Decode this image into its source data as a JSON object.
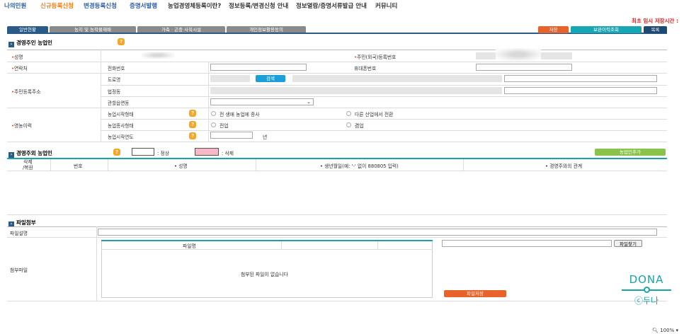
{
  "topnav": {
    "items": [
      "나의민원",
      "신규등록신청",
      "변경등록신청",
      "증명서발행",
      "농업경영체등록이란?",
      "정보등록/변경신청 안내",
      "정보열람/증명서류발급 안내",
      "커뮤니티"
    ],
    "colors": [
      "#2b5caa",
      "#f07d1a",
      "#2b5caa",
      "#2b5caa",
      "#333333",
      "#333333",
      "#333333",
      "#333333"
    ]
  },
  "save_time_label": "최초 임시 저장시간 :",
  "tabs": [
    "일반현황",
    "농지 및 농작물재배",
    "가축 · 곤충 사육시설",
    "개인정보활용동의"
  ],
  "buttons": {
    "save": "저장",
    "history": "보완이력조회",
    "list": "목록"
  },
  "sections": {
    "operator": {
      "title": "경영주인 농업인",
      "name_label": "성명",
      "resident_label": "주민(외국)등록번호",
      "contact_label": "연락처",
      "phone_label": "전화번호",
      "mobile_label": "휴대폰번호",
      "address_label": "주민등록주소",
      "road_label": "도로명",
      "search_btn": "검색",
      "legal_label": "법정동",
      "district_label": "관할읍면동",
      "career_label": "영농이력",
      "start_type_label": "농업시작형태",
      "start_opt1": "전 생애 농업에 종사",
      "start_opt2": "다른 산업에서 전환",
      "work_type_label": "농업종사형태",
      "work_opt1": "전업",
      "work_opt2": "겸업",
      "start_year_label": "농업시작연도",
      "year_unit": "년"
    },
    "members": {
      "title": "경영주외 농업인",
      "legend_normal": ": 정상",
      "legend_deleted": ": 삭제",
      "add_btn": "농업인추가",
      "columns": [
        "삭제\n/복원",
        "번호",
        "• 성명",
        "• 생년월일(예: '-' 없이 880805 입력)",
        "• 경영주와의 관계"
      ]
    },
    "files": {
      "title": "파일첨부",
      "desc_label": "파일설명",
      "attach_label": "첨부파일",
      "filename_col": "파일명",
      "empty_msg": "첨부된 파일이 없습니다",
      "browse_btn": "파일찾기",
      "save_file_btn": "파일저장"
    }
  },
  "watermark": {
    "brand": "DONA",
    "sub": "ⓒ두나"
  },
  "zoom": "100%",
  "colors": {
    "navy": "#2a5a86",
    "orange": "#e8632c",
    "teal": "#17a6b4",
    "green": "#8bc34a",
    "help": "#f5a623"
  }
}
